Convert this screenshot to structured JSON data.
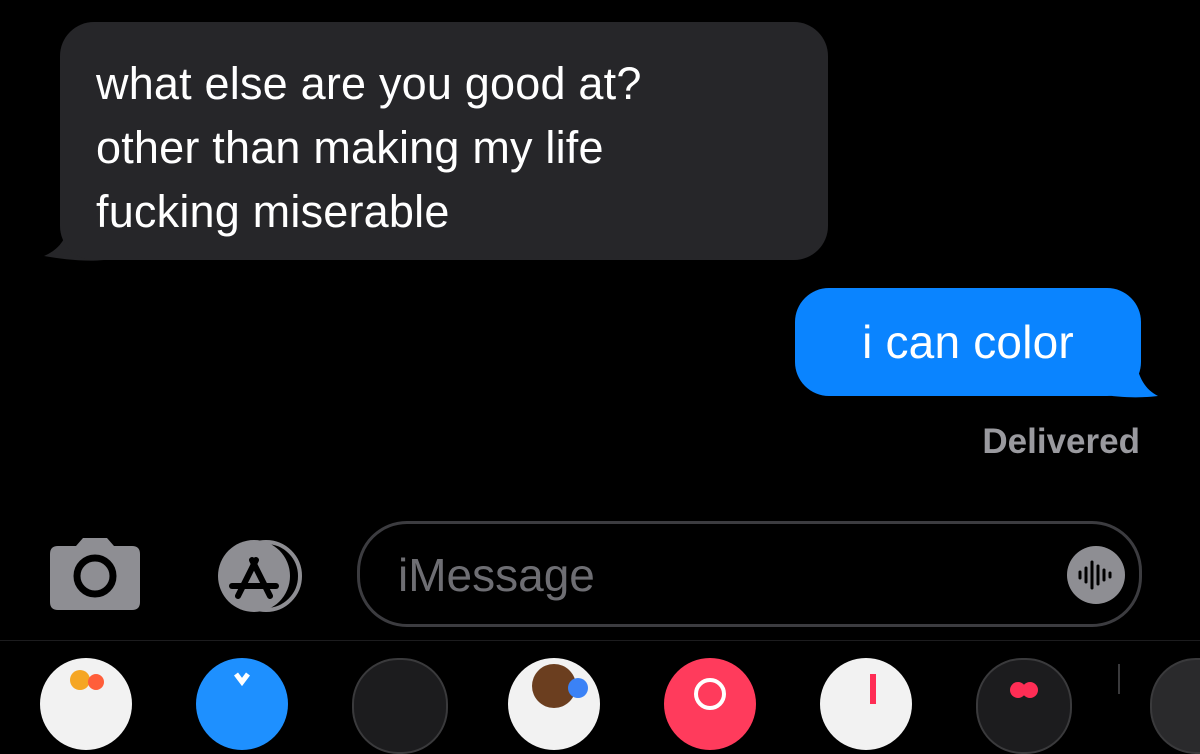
{
  "conversation": {
    "incoming": {
      "lines": [
        "what else are you good at?",
        "other than making my life",
        "fucking miserable"
      ]
    },
    "outgoing": {
      "text": "i can color",
      "status": "Delivered"
    }
  },
  "input_bar": {
    "camera_icon": "camera-icon",
    "apps_icon": "app-store-icon",
    "placeholder": "iMessage",
    "audio_icon": "waveform-icon"
  },
  "app_tray": {
    "apps": [
      {
        "name": "photos-app-icon",
        "color": "#f2f2f2"
      },
      {
        "name": "appstore-app-icon",
        "color": "#1e90ff"
      },
      {
        "name": "dark-app-icon",
        "color": "#1c1c1e"
      },
      {
        "name": "memoji-app-icon",
        "color": "#f2f2f2"
      },
      {
        "name": "search-images-app-icon",
        "color": "#ff3b5c"
      },
      {
        "name": "music-app-icon",
        "color": "#f2f2f2"
      },
      {
        "name": "digital-touch-app-icon",
        "color": "#1c1c1e"
      },
      {
        "name": "more-app-icon",
        "color": "#2a2a2c"
      }
    ]
  },
  "colors": {
    "incoming_bubble": "#262629",
    "outgoing_bubble": "#0a84ff",
    "status_text": "#9a9a9f"
  }
}
